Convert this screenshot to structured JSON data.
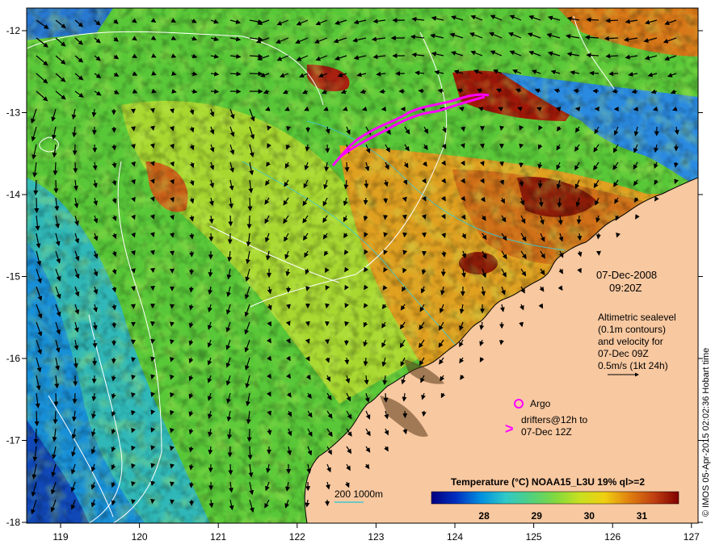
{
  "map": {
    "datetime": {
      "date": "07-Dec-2008",
      "time": "09:20Z"
    },
    "altimetry_note": [
      "Altimetric sealevel",
      "(0.1m contours)",
      "and velocity for",
      "07-Dec 09Z",
      "0.5m/s (1kt 24h)"
    ],
    "argo_label": "Argo",
    "drifters_label": [
      "drifters@12h to",
      "07-Dec 12Z"
    ],
    "drifter_marker": ">",
    "depth_legend": "200  1000m",
    "credit": "© IMOS 05-Apr-2015 02:02:36 Hobart time",
    "colorbar": {
      "title": "Temperature (°C) NOAA15_L3U 19% ql>=2",
      "range": [
        27,
        31.7
      ],
      "ticks": [
        "28",
        "29",
        "30",
        "31"
      ],
      "colors": [
        "#000080",
        "#0030c0",
        "#0090e0",
        "#30c8c8",
        "#50d080",
        "#80d840",
        "#c8e020",
        "#f0d010",
        "#e08010",
        "#c04010",
        "#800000"
      ]
    },
    "x_axis": {
      "ticks": [
        "119",
        "120",
        "121",
        "122",
        "123",
        "124",
        "125",
        "126",
        "127"
      ]
    },
    "y_axis": {
      "ticks": [
        "-12",
        "-13",
        "-14",
        "-15",
        "-16",
        "-17",
        "-18"
      ]
    },
    "colors": {
      "land": "#f8c8a0",
      "drifter": "#ff00ff",
      "contour": "#ffffff",
      "isobath": "#40c8d0"
    }
  }
}
